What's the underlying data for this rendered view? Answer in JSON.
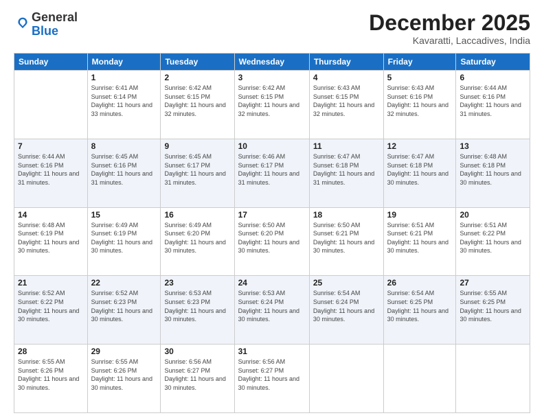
{
  "logo": {
    "general": "General",
    "blue": "Blue"
  },
  "header": {
    "month": "December 2025",
    "location": "Kavaratti, Laccadives, India"
  },
  "weekdays": [
    "Sunday",
    "Monday",
    "Tuesday",
    "Wednesday",
    "Thursday",
    "Friday",
    "Saturday"
  ],
  "weeks": [
    [
      {
        "day": "",
        "sunrise": "",
        "sunset": "",
        "daylight": ""
      },
      {
        "day": "1",
        "sunrise": "Sunrise: 6:41 AM",
        "sunset": "Sunset: 6:14 PM",
        "daylight": "Daylight: 11 hours and 33 minutes."
      },
      {
        "day": "2",
        "sunrise": "Sunrise: 6:42 AM",
        "sunset": "Sunset: 6:15 PM",
        "daylight": "Daylight: 11 hours and 32 minutes."
      },
      {
        "day": "3",
        "sunrise": "Sunrise: 6:42 AM",
        "sunset": "Sunset: 6:15 PM",
        "daylight": "Daylight: 11 hours and 32 minutes."
      },
      {
        "day": "4",
        "sunrise": "Sunrise: 6:43 AM",
        "sunset": "Sunset: 6:15 PM",
        "daylight": "Daylight: 11 hours and 32 minutes."
      },
      {
        "day": "5",
        "sunrise": "Sunrise: 6:43 AM",
        "sunset": "Sunset: 6:16 PM",
        "daylight": "Daylight: 11 hours and 32 minutes."
      },
      {
        "day": "6",
        "sunrise": "Sunrise: 6:44 AM",
        "sunset": "Sunset: 6:16 PM",
        "daylight": "Daylight: 11 hours and 31 minutes."
      }
    ],
    [
      {
        "day": "7",
        "sunrise": "Sunrise: 6:44 AM",
        "sunset": "Sunset: 6:16 PM",
        "daylight": "Daylight: 11 hours and 31 minutes."
      },
      {
        "day": "8",
        "sunrise": "Sunrise: 6:45 AM",
        "sunset": "Sunset: 6:16 PM",
        "daylight": "Daylight: 11 hours and 31 minutes."
      },
      {
        "day": "9",
        "sunrise": "Sunrise: 6:45 AM",
        "sunset": "Sunset: 6:17 PM",
        "daylight": "Daylight: 11 hours and 31 minutes."
      },
      {
        "day": "10",
        "sunrise": "Sunrise: 6:46 AM",
        "sunset": "Sunset: 6:17 PM",
        "daylight": "Daylight: 11 hours and 31 minutes."
      },
      {
        "day": "11",
        "sunrise": "Sunrise: 6:47 AM",
        "sunset": "Sunset: 6:18 PM",
        "daylight": "Daylight: 11 hours and 31 minutes."
      },
      {
        "day": "12",
        "sunrise": "Sunrise: 6:47 AM",
        "sunset": "Sunset: 6:18 PM",
        "daylight": "Daylight: 11 hours and 30 minutes."
      },
      {
        "day": "13",
        "sunrise": "Sunrise: 6:48 AM",
        "sunset": "Sunset: 6:18 PM",
        "daylight": "Daylight: 11 hours and 30 minutes."
      }
    ],
    [
      {
        "day": "14",
        "sunrise": "Sunrise: 6:48 AM",
        "sunset": "Sunset: 6:19 PM",
        "daylight": "Daylight: 11 hours and 30 minutes."
      },
      {
        "day": "15",
        "sunrise": "Sunrise: 6:49 AM",
        "sunset": "Sunset: 6:19 PM",
        "daylight": "Daylight: 11 hours and 30 minutes."
      },
      {
        "day": "16",
        "sunrise": "Sunrise: 6:49 AM",
        "sunset": "Sunset: 6:20 PM",
        "daylight": "Daylight: 11 hours and 30 minutes."
      },
      {
        "day": "17",
        "sunrise": "Sunrise: 6:50 AM",
        "sunset": "Sunset: 6:20 PM",
        "daylight": "Daylight: 11 hours and 30 minutes."
      },
      {
        "day": "18",
        "sunrise": "Sunrise: 6:50 AM",
        "sunset": "Sunset: 6:21 PM",
        "daylight": "Daylight: 11 hours and 30 minutes."
      },
      {
        "day": "19",
        "sunrise": "Sunrise: 6:51 AM",
        "sunset": "Sunset: 6:21 PM",
        "daylight": "Daylight: 11 hours and 30 minutes."
      },
      {
        "day": "20",
        "sunrise": "Sunrise: 6:51 AM",
        "sunset": "Sunset: 6:22 PM",
        "daylight": "Daylight: 11 hours and 30 minutes."
      }
    ],
    [
      {
        "day": "21",
        "sunrise": "Sunrise: 6:52 AM",
        "sunset": "Sunset: 6:22 PM",
        "daylight": "Daylight: 11 hours and 30 minutes."
      },
      {
        "day": "22",
        "sunrise": "Sunrise: 6:52 AM",
        "sunset": "Sunset: 6:23 PM",
        "daylight": "Daylight: 11 hours and 30 minutes."
      },
      {
        "day": "23",
        "sunrise": "Sunrise: 6:53 AM",
        "sunset": "Sunset: 6:23 PM",
        "daylight": "Daylight: 11 hours and 30 minutes."
      },
      {
        "day": "24",
        "sunrise": "Sunrise: 6:53 AM",
        "sunset": "Sunset: 6:24 PM",
        "daylight": "Daylight: 11 hours and 30 minutes."
      },
      {
        "day": "25",
        "sunrise": "Sunrise: 6:54 AM",
        "sunset": "Sunset: 6:24 PM",
        "daylight": "Daylight: 11 hours and 30 minutes."
      },
      {
        "day": "26",
        "sunrise": "Sunrise: 6:54 AM",
        "sunset": "Sunset: 6:25 PM",
        "daylight": "Daylight: 11 hours and 30 minutes."
      },
      {
        "day": "27",
        "sunrise": "Sunrise: 6:55 AM",
        "sunset": "Sunset: 6:25 PM",
        "daylight": "Daylight: 11 hours and 30 minutes."
      }
    ],
    [
      {
        "day": "28",
        "sunrise": "Sunrise: 6:55 AM",
        "sunset": "Sunset: 6:26 PM",
        "daylight": "Daylight: 11 hours and 30 minutes."
      },
      {
        "day": "29",
        "sunrise": "Sunrise: 6:55 AM",
        "sunset": "Sunset: 6:26 PM",
        "daylight": "Daylight: 11 hours and 30 minutes."
      },
      {
        "day": "30",
        "sunrise": "Sunrise: 6:56 AM",
        "sunset": "Sunset: 6:27 PM",
        "daylight": "Daylight: 11 hours and 30 minutes."
      },
      {
        "day": "31",
        "sunrise": "Sunrise: 6:56 AM",
        "sunset": "Sunset: 6:27 PM",
        "daylight": "Daylight: 11 hours and 30 minutes."
      },
      {
        "day": "",
        "sunrise": "",
        "sunset": "",
        "daylight": ""
      },
      {
        "day": "",
        "sunrise": "",
        "sunset": "",
        "daylight": ""
      },
      {
        "day": "",
        "sunrise": "",
        "sunset": "",
        "daylight": ""
      }
    ]
  ]
}
